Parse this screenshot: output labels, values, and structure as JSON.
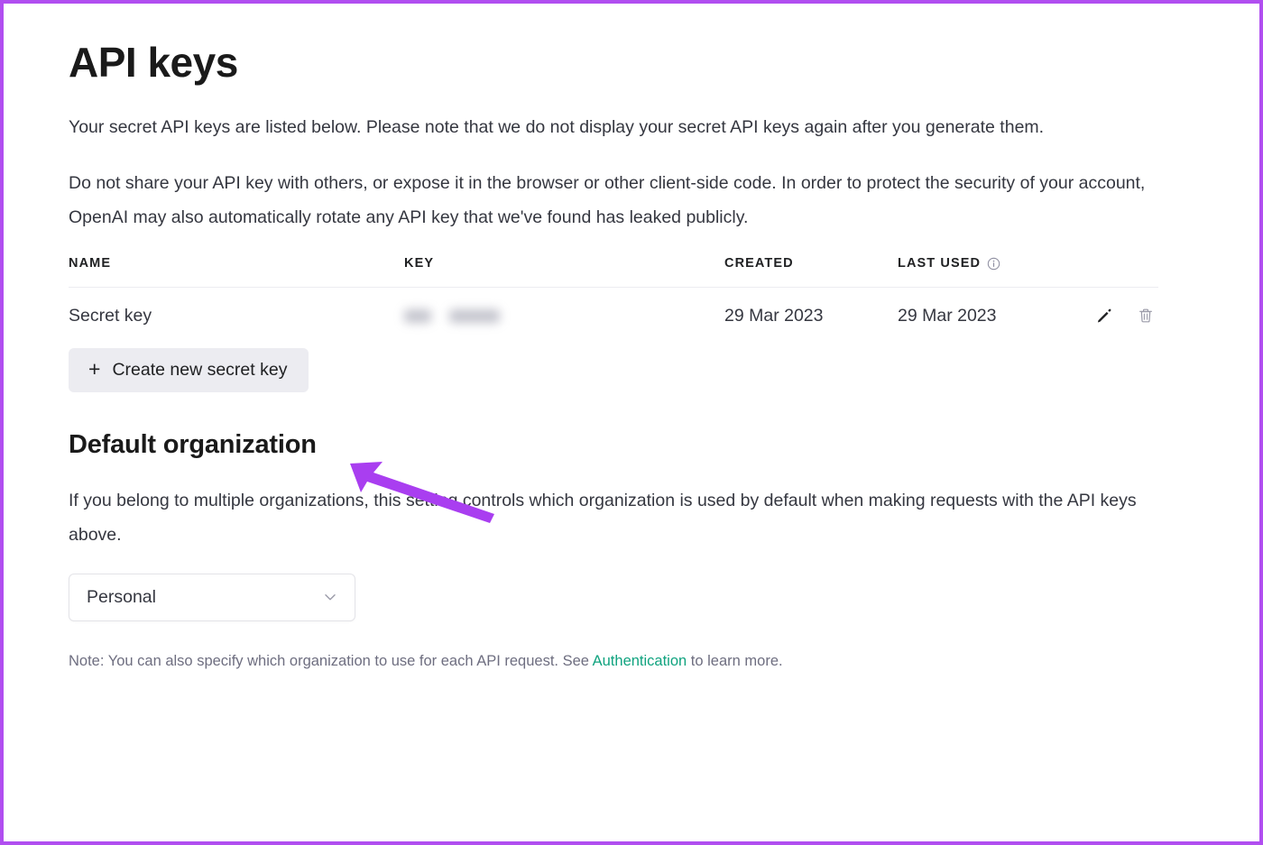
{
  "page": {
    "title": "API keys",
    "intro_paragraph_1": "Your secret API keys are listed below. Please note that we do not display your secret API keys again after you generate them.",
    "intro_paragraph_2": "Do not share your API key with others, or expose it in the browser or other client-side code. In order to protect the security of your account, OpenAI may also automatically rotate any API key that we've found has leaked publicly."
  },
  "table": {
    "headers": {
      "name": "NAME",
      "key": "KEY",
      "created": "CREATED",
      "last_used": "LAST USED",
      "last_used_info_icon": "info-icon"
    },
    "rows": [
      {
        "name": "Secret key",
        "key": "",
        "created": "29 Mar 2023",
        "last_used": "29 Mar 2023",
        "edit_icon": "pencil-icon",
        "delete_icon": "trash-icon"
      }
    ]
  },
  "create_button": {
    "plus": "+",
    "label": "Create new secret key"
  },
  "annotation": {
    "type": "arrow",
    "color": "#a93ef0",
    "points_to": "create-new-secret-key-button"
  },
  "organization": {
    "title": "Default organization",
    "description": "If you belong to multiple organizations, this setting controls which organization is used by default when making requests with the API keys above.",
    "select": {
      "value": "Personal",
      "chevron_icon": "chevron-down-icon"
    },
    "note_before_link": "Note: You can also specify which organization to use for each API request. See ",
    "note_link": "Authentication",
    "note_after_link": " to learn more."
  },
  "colors": {
    "frame": "#b14ef0",
    "link": "#10a37f",
    "button_bg": "#ececf1",
    "arrow": "#a93ef0"
  }
}
